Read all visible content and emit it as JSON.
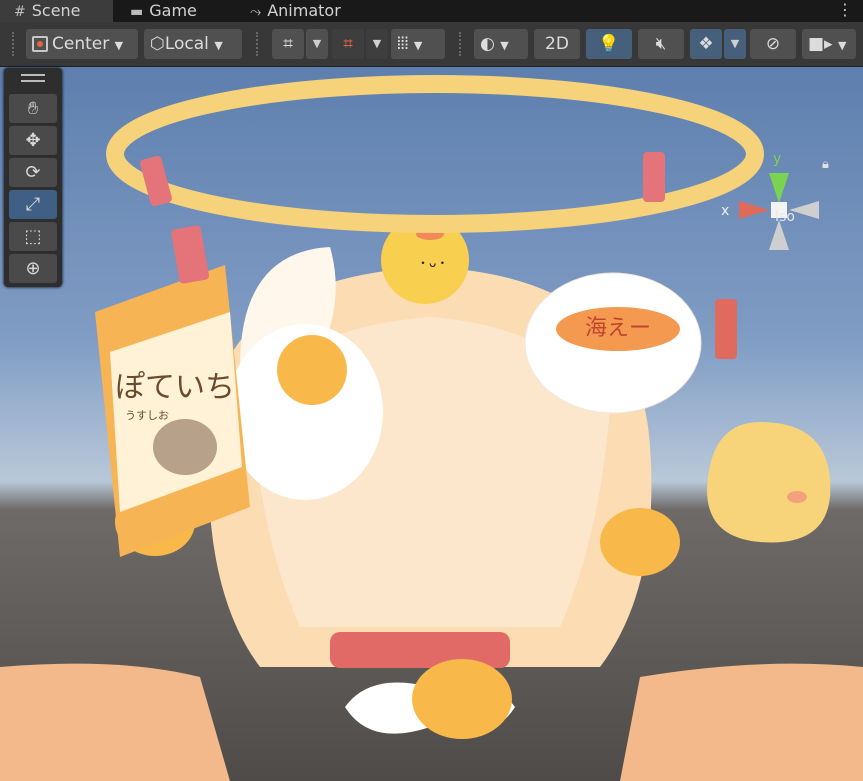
{
  "tabs": [
    {
      "label": "Scene",
      "icon": "#"
    },
    {
      "label": "Game",
      "icon": "gamepad-icon"
    },
    {
      "label": "Animator",
      "icon": "animator-icon"
    }
  ],
  "toolbar": {
    "pivot": "Center",
    "space": "Local",
    "mode_2d": "2D"
  },
  "gizmo": {
    "y": "y",
    "x": "x",
    "projection": "Iso"
  },
  "scene_text": {
    "bag_label": "ぽていち",
    "bag_sub": "うすしお",
    "plate_label": "海えー",
    "colors": {
      "halo": "#f6d27a",
      "bow": "#ff8c8c",
      "hair": "#fbdcb3",
      "collar": "#e26a66",
      "yolk": "#f9b94a"
    }
  }
}
